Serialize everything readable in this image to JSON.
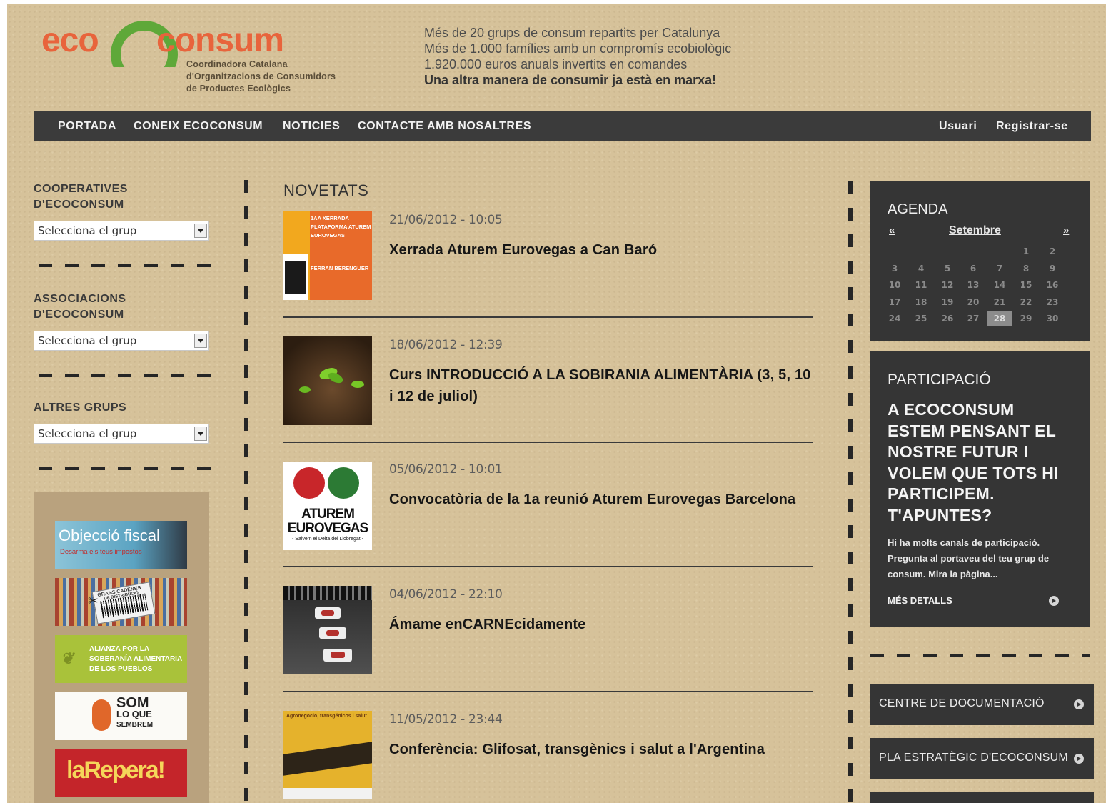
{
  "header": {
    "logo_text": "ecoconsum",
    "logo_sub": [
      "Coordinadora Catalana",
      "d'Organitzacions de Consumidors",
      "de Productes Ecològics"
    ],
    "taglines": [
      "Més de 20 grups de consum repartits per Catalunya",
      "Més de 1.000 famílies amb un compromís ecobiològic",
      "1.920.000 euros anuals invertits en comandes"
    ],
    "tagline_bold": "Una altra manera de consumir ja està en marxa!"
  },
  "nav": {
    "items": [
      "PORTADA",
      "CONEIX ECOCONSUM",
      "NOTICIES",
      "CONTACTE AMB NOSALTRES"
    ],
    "user": "Usuari",
    "register": "Registrar-se"
  },
  "sidebar": {
    "groups": [
      {
        "heading": [
          "COOPERATIVES",
          "D'ECOCONSUM"
        ],
        "select_value": "Selecciona el grup"
      },
      {
        "heading": [
          "ASSOCIACIONS",
          "D'ECOCONSUM"
        ],
        "select_value": "Selecciona el grup"
      },
      {
        "heading": [
          "ALTRES GRUPS"
        ],
        "select_value": "Selecciona el grup"
      }
    ],
    "banners": [
      {
        "name": "objeccio-fiscal",
        "line1": "Objecció fiscal",
        "line2": "Desarma els teus impostos"
      },
      {
        "name": "grans-cadenes",
        "line1": "GRANS CADENES",
        "line2": "DE DISTRIBUCIÓ"
      },
      {
        "name": "alianza-soberania",
        "line1": "ALIANZA POR LA",
        "line2": "SOBERANÍA ALIMENTARIA",
        "line3": "DE LOS PUEBLOS"
      },
      {
        "name": "som-lo-que-sembrem",
        "line1": "SOM",
        "line2": "LO QUE",
        "line3": "SEMBREM"
      },
      {
        "name": "la-repera",
        "line1": "laRepera!"
      }
    ]
  },
  "news": {
    "title": "NOVETATS",
    "items": [
      {
        "date": "21/06/2012 - 10:05",
        "title": "Xerrada Aturem Eurovegas a Can Baró",
        "thumb_text": [
          "1AA XERRADA",
          "PLATAFORMA ATUREM",
          "EUROVEGAS",
          "FERRAN BERENGUER"
        ]
      },
      {
        "date": "18/06/2012 - 12:39",
        "title": "Curs INTRODUCCIÓ A LA SOBIRANIA ALIMENTÀRIA (3, 5, 10 i 12 de juliol)"
      },
      {
        "date": "05/06/2012 - 10:01",
        "title": "Convocatòria de la 1a reunió Aturem Eurovegas Barcelona",
        "thumb_text": [
          "ATUREM",
          "EUROVEGAS",
          "- Salvem el Delta del Llobregat -"
        ]
      },
      {
        "date": "04/06/2012 - 22:10",
        "title": "Ámame enCARNEcidamente"
      },
      {
        "date": "11/05/2012 - 23:44",
        "title": "Conferència: Glifosat, transgènics i salut a l'Argentina",
        "thumb_text": [
          "Agronegocio, transgénicos i salut"
        ]
      }
    ]
  },
  "agenda": {
    "title": "AGENDA",
    "prev": "«",
    "month": "Setembre",
    "next": "»",
    "weeks": [
      [
        "",
        "",
        "",
        "",
        "",
        "1",
        "2"
      ],
      [
        "3",
        "4",
        "5",
        "6",
        "7",
        "8",
        "9"
      ],
      [
        "10",
        "11",
        "12",
        "13",
        "14",
        "15",
        "16"
      ],
      [
        "17",
        "18",
        "19",
        "20",
        "21",
        "22",
        "23"
      ],
      [
        "24",
        "25",
        "26",
        "27",
        "28",
        "29",
        "30"
      ]
    ],
    "today": "28"
  },
  "participacio": {
    "title": "PARTICIPACIÓ",
    "headline": [
      "A ECOCONSUM",
      "ESTEM PENSANT EL",
      "NOSTRE FUTUR I",
      "VOLEM QUE TOTS HI",
      "PARTICIPEM.",
      "T'APUNTES?"
    ],
    "body": [
      "Hi ha molts canals de participació.",
      "Pregunta al portaveu del teu grup de",
      "consum. Mira la pàgina..."
    ],
    "more": "MÉS DETALLS"
  },
  "links": [
    "CENTRE DE DOCUMENTACIÓ",
    "PLA ESTRATÈGIC D'ECOCONSUM"
  ],
  "colors": {
    "background": "#d6c29a",
    "dark_panel": "#353535",
    "logo_orange": "#e8643c",
    "logo_green": "#5fa839"
  }
}
